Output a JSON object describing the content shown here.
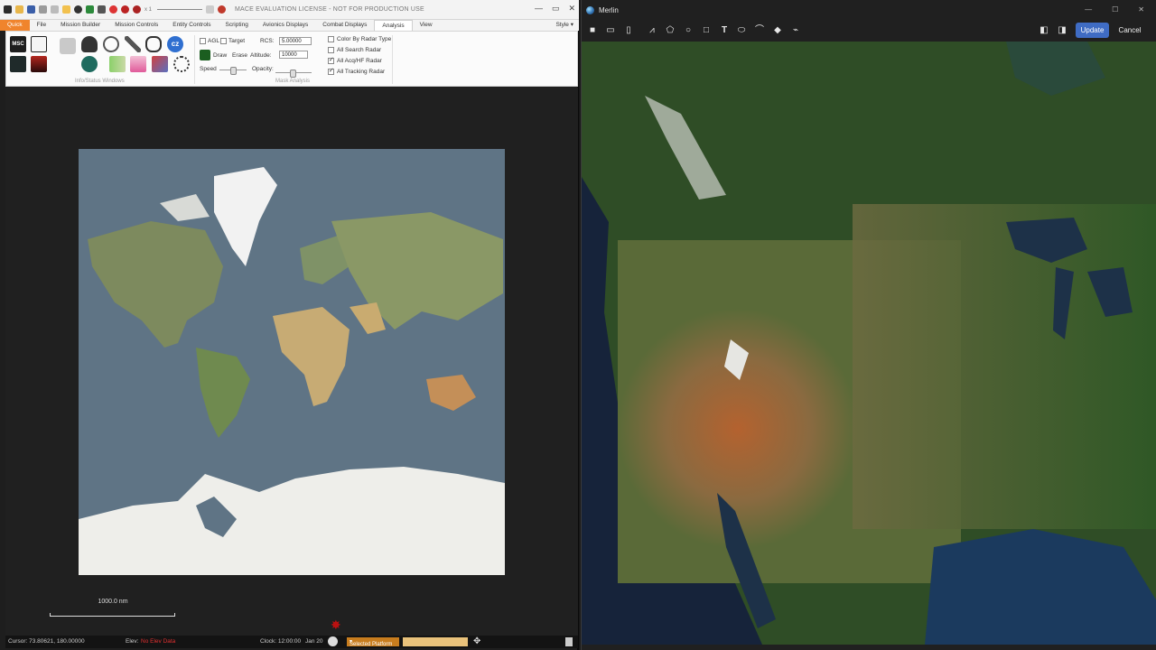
{
  "mace": {
    "title_bar": {
      "license_text": "MACE EVALUATION LICENSE - NOT FOR PRODUCTION USE",
      "zoom": "x 1"
    },
    "tabs": [
      "Quick",
      "File",
      "Mission Builder",
      "Mission Controls",
      "Entity Controls",
      "Scripting",
      "Avionics Displays",
      "Combat Displays",
      "Analysis",
      "View"
    ],
    "active_tab": "Analysis",
    "style_label": "Style",
    "ribbon": {
      "groups": {
        "info_status": "Info/Status Windows",
        "mask_analysis": "Mask Analysis"
      },
      "agl_label": "AGL",
      "target_label": "Target",
      "rcs_label": "RCS:",
      "rcs_value": "5.00000",
      "draw_label": "Draw",
      "erase_label": "Erase",
      "altitude_label": "Altitude:",
      "altitude_value": "10000",
      "speed_label": "Speed",
      "opacity_label": "Opacity:",
      "color_by_radar": "Color By Radar Type",
      "all_search_radar": "All Search Radar",
      "all_acq_radar": "All Acq/HF Radar",
      "all_tracking_radar": "All Tracking Radar",
      "msc_label": "MSC"
    },
    "scale_bar_label": "1000.0 nm",
    "status": {
      "cursor": "Cursor: 73.80621, 180.00000",
      "elev_label": "Elev:",
      "elev_value": "No Elev Data",
      "clock": "Clock: 12:00:00",
      "date": "Jan 20",
      "platform": "Selected Platform"
    }
  },
  "merlin": {
    "title": "Merlin",
    "update_label": "Update",
    "cancel_label": "Cancel"
  },
  "colors": {
    "quick_tab": "#f0842c",
    "update_button": "#3f6cc4",
    "ocean_world": "#5f7485",
    "platform_field": "#c87d1e"
  }
}
